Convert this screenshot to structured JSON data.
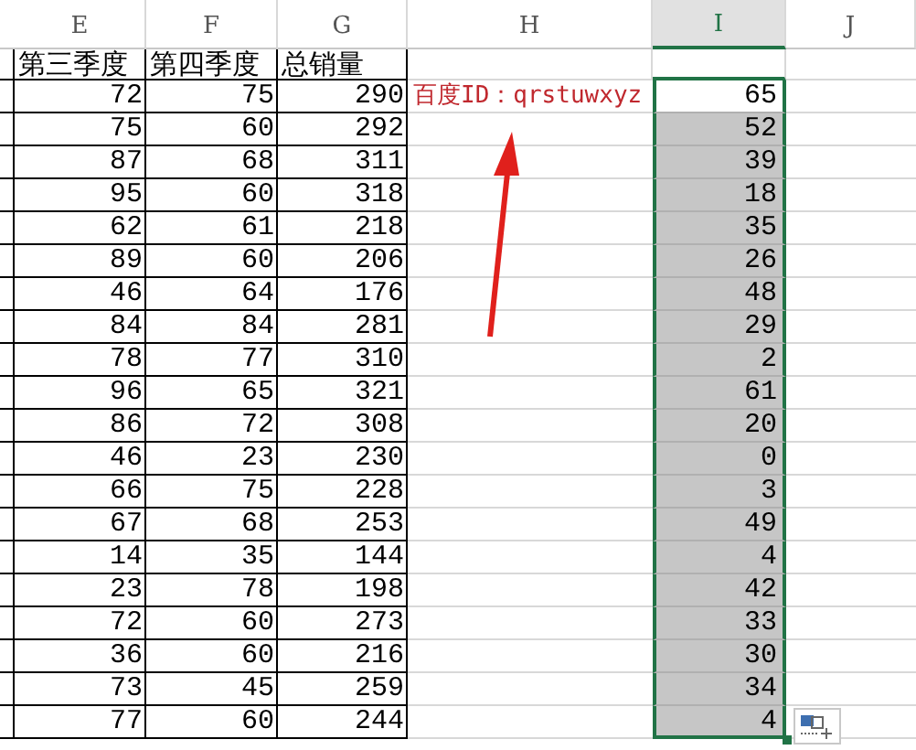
{
  "column_headers": [
    {
      "label": "E",
      "selected": false
    },
    {
      "label": "F",
      "selected": false
    },
    {
      "label": "G",
      "selected": false
    },
    {
      "label": "H",
      "selected": false
    },
    {
      "label": "I",
      "selected": true
    },
    {
      "label": "J",
      "selected": false
    }
  ],
  "table": {
    "header": [
      "第三季度",
      "第四季度",
      "总销量"
    ],
    "rows": [
      {
        "e": "72",
        "f": "75",
        "g": "290"
      },
      {
        "e": "75",
        "f": "60",
        "g": "292"
      },
      {
        "e": "87",
        "f": "68",
        "g": "311"
      },
      {
        "e": "95",
        "f": "60",
        "g": "318"
      },
      {
        "e": "62",
        "f": "61",
        "g": "218"
      },
      {
        "e": "89",
        "f": "60",
        "g": "206"
      },
      {
        "e": "46",
        "f": "64",
        "g": "176"
      },
      {
        "e": "84",
        "f": "84",
        "g": "281"
      },
      {
        "e": "78",
        "f": "77",
        "g": "310"
      },
      {
        "e": "96",
        "f": "65",
        "g": "321"
      },
      {
        "e": "86",
        "f": "72",
        "g": "308"
      },
      {
        "e": "46",
        "f": "23",
        "g": "230"
      },
      {
        "e": "66",
        "f": "75",
        "g": "228"
      },
      {
        "e": "67",
        "f": "68",
        "g": "253"
      },
      {
        "e": "14",
        "f": "35",
        "g": "144"
      },
      {
        "e": "23",
        "f": "78",
        "g": "198"
      },
      {
        "e": "72",
        "f": "60",
        "g": "273"
      },
      {
        "e": "36",
        "f": "60",
        "g": "216"
      },
      {
        "e": "73",
        "f": "45",
        "g": "259"
      },
      {
        "e": "77",
        "f": "60",
        "g": "244"
      }
    ]
  },
  "note": "百度ID：qrstuwxyz",
  "column_i": [
    {
      "text": "65",
      "active": true
    },
    {
      "text": "52",
      "active": false
    },
    {
      "text": "39",
      "active": false
    },
    {
      "text": "18",
      "active": false
    },
    {
      "text": "35",
      "active": false
    },
    {
      "text": "26",
      "active": false
    },
    {
      "text": "48",
      "active": false
    },
    {
      "text": "29",
      "active": false
    },
    {
      "text": "2",
      "active": false
    },
    {
      "text": "61",
      "active": false
    },
    {
      "text": "20",
      "active": false
    },
    {
      "text": "0",
      "active": false
    },
    {
      "text": "3",
      "active": false
    },
    {
      "text": "49",
      "active": false
    },
    {
      "text": "4",
      "active": false
    },
    {
      "text": "42",
      "active": false
    },
    {
      "text": "33",
      "active": false
    },
    {
      "text": "30",
      "active": false
    },
    {
      "text": "34",
      "active": false
    },
    {
      "text": "4",
      "active": false
    }
  ]
}
